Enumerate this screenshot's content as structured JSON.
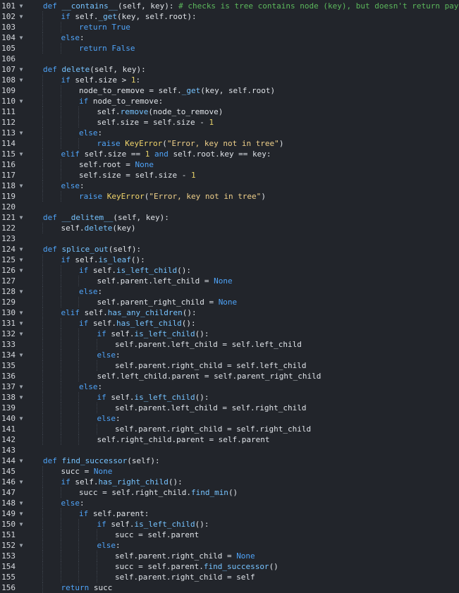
{
  "editor": {
    "lines": [
      {
        "n": "101",
        "fold": true,
        "indent": 0,
        "t": [
          [
            "kw",
            "def "
          ],
          [
            "fn",
            "__contains__"
          ],
          [
            "txt",
            "(self, key): "
          ],
          [
            "cmt",
            "# checks is tree contains node (key), but doesn't return payload"
          ]
        ]
      },
      {
        "n": "102",
        "fold": true,
        "indent": 1,
        "t": [
          [
            "kw",
            "if "
          ],
          [
            "txt",
            "self."
          ],
          [
            "fn",
            "_get"
          ],
          [
            "txt",
            "(key, self.root):"
          ]
        ]
      },
      {
        "n": "103",
        "fold": false,
        "indent": 2,
        "t": [
          [
            "kw",
            "return "
          ],
          [
            "bi",
            "True"
          ]
        ]
      },
      {
        "n": "104",
        "fold": true,
        "indent": 1,
        "t": [
          [
            "kw",
            "else"
          ],
          [
            "txt",
            ":"
          ]
        ]
      },
      {
        "n": "105",
        "fold": false,
        "indent": 2,
        "t": [
          [
            "kw",
            "return "
          ],
          [
            "bi",
            "False"
          ]
        ]
      },
      {
        "n": "106",
        "fold": false,
        "indent": 0,
        "t": []
      },
      {
        "n": "107",
        "fold": true,
        "indent": 0,
        "t": [
          [
            "kw",
            "def "
          ],
          [
            "fn",
            "delete"
          ],
          [
            "txt",
            "(self, key):"
          ]
        ]
      },
      {
        "n": "108",
        "fold": true,
        "indent": 1,
        "t": [
          [
            "kw",
            "if "
          ],
          [
            "txt",
            "self.size > "
          ],
          [
            "num",
            "1"
          ],
          [
            "txt",
            ":"
          ]
        ]
      },
      {
        "n": "109",
        "fold": false,
        "indent": 2,
        "t": [
          [
            "txt",
            "node_to_remove = self."
          ],
          [
            "fn",
            "_get"
          ],
          [
            "txt",
            "(key, self.root)"
          ]
        ]
      },
      {
        "n": "110",
        "fold": true,
        "indent": 2,
        "t": [
          [
            "kw",
            "if "
          ],
          [
            "txt",
            "node_to_remove:"
          ]
        ]
      },
      {
        "n": "111",
        "fold": false,
        "indent": 3,
        "t": [
          [
            "txt",
            "self."
          ],
          [
            "fn",
            "remove"
          ],
          [
            "txt",
            "(node_to_remove)"
          ]
        ]
      },
      {
        "n": "112",
        "fold": false,
        "indent": 3,
        "t": [
          [
            "txt",
            "self.size = self.size - "
          ],
          [
            "num",
            "1"
          ]
        ]
      },
      {
        "n": "113",
        "fold": true,
        "indent": 2,
        "t": [
          [
            "kw",
            "else"
          ],
          [
            "txt",
            ":"
          ]
        ]
      },
      {
        "n": "114",
        "fold": false,
        "indent": 3,
        "t": [
          [
            "kw",
            "raise "
          ],
          [
            "cls",
            "KeyError"
          ],
          [
            "txt",
            "("
          ],
          [
            "str",
            "\"Error, key not in tree\""
          ],
          [
            "txt",
            ")"
          ]
        ]
      },
      {
        "n": "115",
        "fold": true,
        "indent": 1,
        "t": [
          [
            "kw",
            "elif "
          ],
          [
            "txt",
            "self.size == "
          ],
          [
            "num",
            "1"
          ],
          [
            "kw",
            " and "
          ],
          [
            "txt",
            "self.root.key == key:"
          ]
        ]
      },
      {
        "n": "116",
        "fold": false,
        "indent": 2,
        "t": [
          [
            "txt",
            "self.root = "
          ],
          [
            "bi",
            "None"
          ]
        ]
      },
      {
        "n": "117",
        "fold": false,
        "indent": 2,
        "t": [
          [
            "txt",
            "self.size = self.size - "
          ],
          [
            "num",
            "1"
          ]
        ]
      },
      {
        "n": "118",
        "fold": true,
        "indent": 1,
        "t": [
          [
            "kw",
            "else"
          ],
          [
            "txt",
            ":"
          ]
        ]
      },
      {
        "n": "119",
        "fold": false,
        "indent": 2,
        "t": [
          [
            "kw",
            "raise "
          ],
          [
            "cls",
            "KeyError"
          ],
          [
            "txt",
            "("
          ],
          [
            "str",
            "\"Error, key not in tree\""
          ],
          [
            "txt",
            ")"
          ]
        ]
      },
      {
        "n": "120",
        "fold": false,
        "indent": 0,
        "t": []
      },
      {
        "n": "121",
        "fold": true,
        "indent": 0,
        "t": [
          [
            "kw",
            "def "
          ],
          [
            "fn",
            "__delitem__"
          ],
          [
            "txt",
            "(self, key):"
          ]
        ]
      },
      {
        "n": "122",
        "fold": false,
        "indent": 1,
        "t": [
          [
            "txt",
            "self."
          ],
          [
            "fn",
            "delete"
          ],
          [
            "txt",
            "(key)"
          ]
        ]
      },
      {
        "n": "123",
        "fold": false,
        "indent": 0,
        "t": []
      },
      {
        "n": "124",
        "fold": true,
        "indent": 0,
        "t": [
          [
            "kw",
            "def "
          ],
          [
            "fn",
            "splice_out"
          ],
          [
            "txt",
            "(self):"
          ]
        ]
      },
      {
        "n": "125",
        "fold": true,
        "indent": 1,
        "t": [
          [
            "kw",
            "if "
          ],
          [
            "txt",
            "self."
          ],
          [
            "fn",
            "is_leaf"
          ],
          [
            "txt",
            "():"
          ]
        ]
      },
      {
        "n": "126",
        "fold": true,
        "indent": 2,
        "t": [
          [
            "kw",
            "if "
          ],
          [
            "txt",
            "self."
          ],
          [
            "fn",
            "is_left_child"
          ],
          [
            "txt",
            "():"
          ]
        ]
      },
      {
        "n": "127",
        "fold": false,
        "indent": 3,
        "t": [
          [
            "txt",
            "self.parent.left_child = "
          ],
          [
            "bi",
            "None"
          ]
        ]
      },
      {
        "n": "128",
        "fold": true,
        "indent": 2,
        "t": [
          [
            "kw",
            "else"
          ],
          [
            "txt",
            ":"
          ]
        ]
      },
      {
        "n": "129",
        "fold": false,
        "indent": 3,
        "t": [
          [
            "txt",
            "self.parent_right_child = "
          ],
          [
            "bi",
            "None"
          ]
        ]
      },
      {
        "n": "130",
        "fold": true,
        "indent": 1,
        "t": [
          [
            "kw",
            "elif "
          ],
          [
            "txt",
            "self."
          ],
          [
            "fn",
            "has_any_children"
          ],
          [
            "txt",
            "():"
          ]
        ]
      },
      {
        "n": "131",
        "fold": true,
        "indent": 2,
        "t": [
          [
            "kw",
            "if "
          ],
          [
            "txt",
            "self."
          ],
          [
            "fn",
            "has_left_child"
          ],
          [
            "txt",
            "():"
          ]
        ]
      },
      {
        "n": "132",
        "fold": true,
        "indent": 3,
        "t": [
          [
            "kw",
            "if "
          ],
          [
            "txt",
            "self."
          ],
          [
            "fn",
            "is_left_child"
          ],
          [
            "txt",
            "():"
          ]
        ]
      },
      {
        "n": "133",
        "fold": false,
        "indent": 4,
        "t": [
          [
            "txt",
            "self.parent.left_child = self.left_child"
          ]
        ]
      },
      {
        "n": "134",
        "fold": true,
        "indent": 3,
        "t": [
          [
            "kw",
            "else"
          ],
          [
            "txt",
            ":"
          ]
        ]
      },
      {
        "n": "135",
        "fold": false,
        "indent": 4,
        "t": [
          [
            "txt",
            "self.parent.right_child = self.left_child"
          ]
        ]
      },
      {
        "n": "136",
        "fold": false,
        "indent": 3,
        "t": [
          [
            "txt",
            "self.left_child.parent = self.parent_right_child"
          ]
        ]
      },
      {
        "n": "137",
        "fold": true,
        "indent": 2,
        "t": [
          [
            "kw",
            "else"
          ],
          [
            "txt",
            ":"
          ]
        ]
      },
      {
        "n": "138",
        "fold": true,
        "indent": 3,
        "t": [
          [
            "kw",
            "if "
          ],
          [
            "txt",
            "self."
          ],
          [
            "fn",
            "is_left_child"
          ],
          [
            "txt",
            "():"
          ]
        ]
      },
      {
        "n": "139",
        "fold": false,
        "indent": 4,
        "t": [
          [
            "txt",
            "self.parent.left_child = self.right_child"
          ]
        ]
      },
      {
        "n": "140",
        "fold": true,
        "indent": 3,
        "t": [
          [
            "kw",
            "else"
          ],
          [
            "txt",
            ":"
          ]
        ]
      },
      {
        "n": "141",
        "fold": false,
        "indent": 4,
        "t": [
          [
            "txt",
            "self.parent.right_child = self.right_child"
          ]
        ]
      },
      {
        "n": "142",
        "fold": false,
        "indent": 3,
        "t": [
          [
            "txt",
            "self.right_child.parent = self.parent"
          ]
        ]
      },
      {
        "n": "143",
        "fold": false,
        "indent": 0,
        "t": []
      },
      {
        "n": "144",
        "fold": true,
        "indent": 0,
        "t": [
          [
            "kw",
            "def "
          ],
          [
            "fn",
            "find_successor"
          ],
          [
            "txt",
            "(self):"
          ]
        ]
      },
      {
        "n": "145",
        "fold": false,
        "indent": 1,
        "t": [
          [
            "txt",
            "succ = "
          ],
          [
            "bi",
            "None"
          ]
        ]
      },
      {
        "n": "146",
        "fold": true,
        "indent": 1,
        "t": [
          [
            "kw",
            "if "
          ],
          [
            "txt",
            "self."
          ],
          [
            "fn",
            "has_right_child"
          ],
          [
            "txt",
            "():"
          ]
        ]
      },
      {
        "n": "147",
        "fold": false,
        "indent": 2,
        "t": [
          [
            "txt",
            "succ = self.right_child."
          ],
          [
            "fn",
            "find_min"
          ],
          [
            "txt",
            "()"
          ]
        ]
      },
      {
        "n": "148",
        "fold": true,
        "indent": 1,
        "t": [
          [
            "kw",
            "else"
          ],
          [
            "txt",
            ":"
          ]
        ]
      },
      {
        "n": "149",
        "fold": true,
        "indent": 2,
        "t": [
          [
            "kw",
            "if "
          ],
          [
            "txt",
            "self.parent:"
          ]
        ]
      },
      {
        "n": "150",
        "fold": true,
        "indent": 3,
        "t": [
          [
            "kw",
            "if "
          ],
          [
            "txt",
            "self."
          ],
          [
            "fn",
            "is_left_child"
          ],
          [
            "txt",
            "():"
          ]
        ]
      },
      {
        "n": "151",
        "fold": false,
        "indent": 4,
        "t": [
          [
            "txt",
            "succ = self.parent"
          ]
        ]
      },
      {
        "n": "152",
        "fold": true,
        "indent": 3,
        "t": [
          [
            "kw",
            "else"
          ],
          [
            "txt",
            ":"
          ]
        ]
      },
      {
        "n": "153",
        "fold": false,
        "indent": 4,
        "t": [
          [
            "txt",
            "self.parent.right_child = "
          ],
          [
            "bi",
            "None"
          ]
        ]
      },
      {
        "n": "154",
        "fold": false,
        "indent": 4,
        "t": [
          [
            "txt",
            "succ = self.parent."
          ],
          [
            "fn",
            "find_successor"
          ],
          [
            "txt",
            "()"
          ]
        ]
      },
      {
        "n": "155",
        "fold": false,
        "indent": 4,
        "t": [
          [
            "txt",
            "self.parent.right_child = self"
          ]
        ]
      },
      {
        "n": "156",
        "fold": false,
        "indent": 1,
        "t": [
          [
            "kw",
            "return "
          ],
          [
            "txt",
            "succ"
          ]
        ]
      }
    ]
  }
}
